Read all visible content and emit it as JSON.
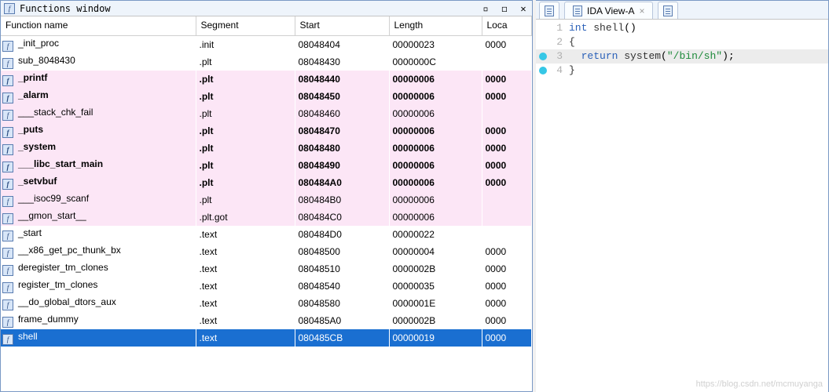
{
  "window": {
    "title": "Functions window",
    "columns": [
      "Function name",
      "Segment",
      "Start",
      "Length",
      "Loca"
    ]
  },
  "functions": [
    {
      "name": "_init_proc",
      "seg": ".init",
      "start": "08048404",
      "len": "00000023",
      "loc": "0000",
      "bold": false,
      "pink": false,
      "selected": false
    },
    {
      "name": "sub_8048430",
      "seg": ".plt",
      "start": "08048430",
      "len": "0000000C",
      "loc": "",
      "bold": false,
      "pink": false,
      "selected": false
    },
    {
      "name": "_printf",
      "seg": ".plt",
      "start": "08048440",
      "len": "00000006",
      "loc": "0000",
      "bold": true,
      "pink": true,
      "selected": false
    },
    {
      "name": "_alarm",
      "seg": ".plt",
      "start": "08048450",
      "len": "00000006",
      "loc": "0000",
      "bold": true,
      "pink": true,
      "selected": false
    },
    {
      "name": "___stack_chk_fail",
      "seg": ".plt",
      "start": "08048460",
      "len": "00000006",
      "loc": "",
      "bold": false,
      "pink": true,
      "selected": false
    },
    {
      "name": "_puts",
      "seg": ".plt",
      "start": "08048470",
      "len": "00000006",
      "loc": "0000",
      "bold": true,
      "pink": true,
      "selected": false
    },
    {
      "name": "_system",
      "seg": ".plt",
      "start": "08048480",
      "len": "00000006",
      "loc": "0000",
      "bold": true,
      "pink": true,
      "selected": false
    },
    {
      "name": "___libc_start_main",
      "seg": ".plt",
      "start": "08048490",
      "len": "00000006",
      "loc": "0000",
      "bold": true,
      "pink": true,
      "selected": false
    },
    {
      "name": "_setvbuf",
      "seg": ".plt",
      "start": "080484A0",
      "len": "00000006",
      "loc": "0000",
      "bold": true,
      "pink": true,
      "selected": false
    },
    {
      "name": "___isoc99_scanf",
      "seg": ".plt",
      "start": "080484B0",
      "len": "00000006",
      "loc": "",
      "bold": false,
      "pink": true,
      "selected": false
    },
    {
      "name": "__gmon_start__",
      "seg": ".plt.got",
      "start": "080484C0",
      "len": "00000006",
      "loc": "",
      "bold": false,
      "pink": true,
      "selected": false
    },
    {
      "name": "_start",
      "seg": ".text",
      "start": "080484D0",
      "len": "00000022",
      "loc": "",
      "bold": false,
      "pink": false,
      "selected": false
    },
    {
      "name": "__x86_get_pc_thunk_bx",
      "seg": ".text",
      "start": "08048500",
      "len": "00000004",
      "loc": "0000",
      "bold": false,
      "pink": false,
      "selected": false
    },
    {
      "name": "deregister_tm_clones",
      "seg": ".text",
      "start": "08048510",
      "len": "0000002B",
      "loc": "0000",
      "bold": false,
      "pink": false,
      "selected": false
    },
    {
      "name": "register_tm_clones",
      "seg": ".text",
      "start": "08048540",
      "len": "00000035",
      "loc": "0000",
      "bold": false,
      "pink": false,
      "selected": false
    },
    {
      "name": "__do_global_dtors_aux",
      "seg": ".text",
      "start": "08048580",
      "len": "0000001E",
      "loc": "0000",
      "bold": false,
      "pink": false,
      "selected": false
    },
    {
      "name": "frame_dummy",
      "seg": ".text",
      "start": "080485A0",
      "len": "0000002B",
      "loc": "0000",
      "bold": false,
      "pink": false,
      "selected": false
    },
    {
      "name": "shell",
      "seg": ".text",
      "start": "080485CB",
      "len": "00000019",
      "loc": "0000",
      "bold": false,
      "pink": false,
      "selected": true
    }
  ],
  "tabs": {
    "ida_view": "IDA View-A"
  },
  "code": {
    "lines": [
      {
        "n": "1",
        "bp": false,
        "hl": false,
        "html": "<span class='kw-type'>int</span> <span class='fn-name'>shell</span>()"
      },
      {
        "n": "2",
        "bp": false,
        "hl": false,
        "html": "<span class='brace'>{</span>"
      },
      {
        "n": "3",
        "bp": true,
        "hl": true,
        "html": "  <span class='kw-ret'>return</span> <span class='call'>system</span>(<span class='str'>\"/bin/sh\"</span>);"
      },
      {
        "n": "4",
        "bp": true,
        "hl": false,
        "html": "<span class='brace'>}</span>"
      }
    ]
  },
  "watermark": "https://blog.csdn.net/mcmuyanga"
}
